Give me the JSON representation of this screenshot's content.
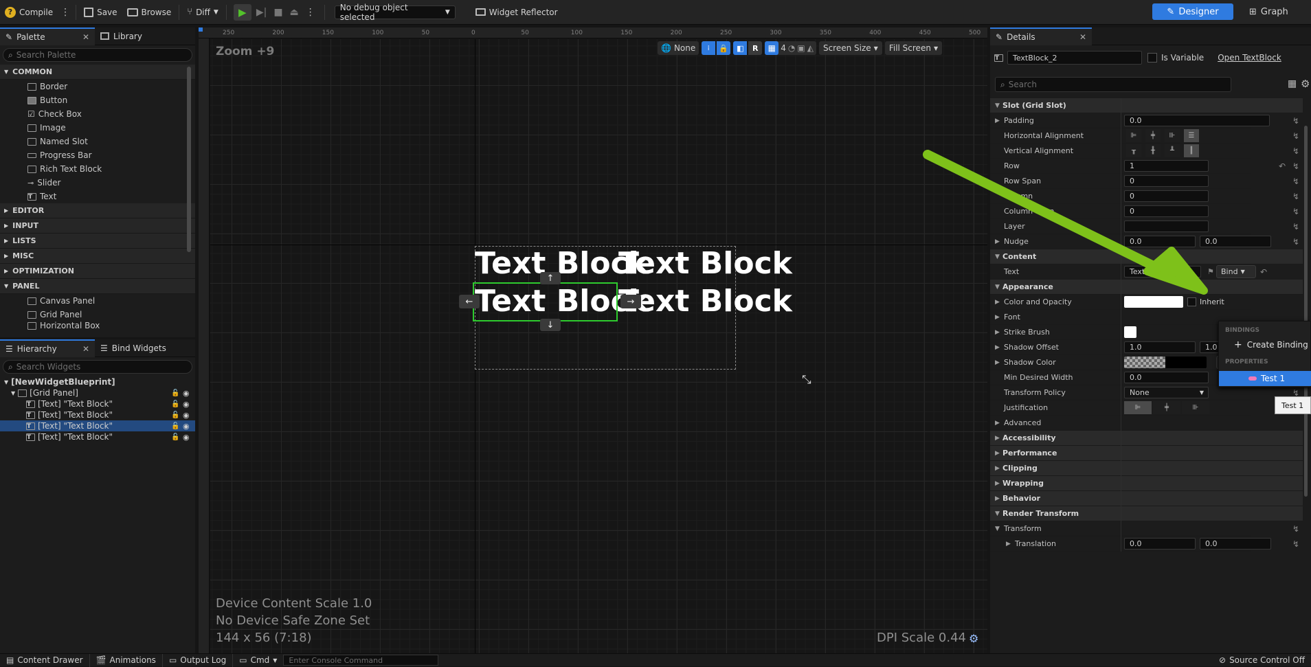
{
  "toolbar": {
    "compile": "Compile",
    "save": "Save",
    "browse": "Browse",
    "diff": "Diff",
    "debug_select": "No debug object selected",
    "widget_reflector": "Widget Reflector",
    "designer": "Designer",
    "graph": "Graph"
  },
  "palette": {
    "tab": "Palette",
    "library_tab": "Library",
    "search_placeholder": "Search Palette",
    "common": "COMMON",
    "items": [
      "Border",
      "Button",
      "Check Box",
      "Image",
      "Named Slot",
      "Progress Bar",
      "Rich Text Block",
      "Slider",
      "Text"
    ],
    "categories": [
      "EDITOR",
      "INPUT",
      "LISTS",
      "MISC",
      "OPTIMIZATION",
      "PANEL"
    ],
    "panel_items": [
      "Canvas Panel",
      "Grid Panel",
      "Horizontal Box"
    ]
  },
  "hierarchy": {
    "tab": "Hierarchy",
    "bind_tab": "Bind Widgets",
    "search_placeholder": "Search Widgets",
    "root": "[NewWidgetBlueprint]",
    "grid": "[Grid Panel]",
    "rows": [
      "[Text] \"Text Block\"",
      "[Text] \"Text Block\"",
      "[Text] \"Text Block\"",
      "[Text] \"Text Block\""
    ]
  },
  "canvas": {
    "zoom": "Zoom +9",
    "none_label": "None",
    "r_label": "R",
    "grid_value": "4",
    "screen_size": "Screen Size",
    "fill_screen": "Fill Screen",
    "text_block": "Text Block",
    "device_scale": "Device Content Scale 1.0",
    "safe_zone": "No Device Safe Zone Set",
    "size": "144 x 56 (7:18)",
    "dpi": "DPI Scale 0.44",
    "ruler_top": [
      "250",
      "200",
      "150",
      "100",
      "50",
      "0",
      "50",
      "100",
      "150",
      "200",
      "250",
      "300",
      "350",
      "400",
      "450",
      "500"
    ]
  },
  "details": {
    "tab": "Details",
    "widget_name": "TextBlock_2",
    "is_variable": "Is Variable",
    "open_link": "Open TextBlock",
    "search_placeholder": "Search",
    "slot_section": "Slot (Grid Slot)",
    "padding": "Padding",
    "padding_value": "0.0",
    "h_align": "Horizontal Alignment",
    "v_align": "Vertical Alignment",
    "row": "Row",
    "row_value": "1",
    "row_span": "Row Span",
    "row_span_value": "0",
    "column": "Column",
    "column_value": "0",
    "column_span": "Column Span",
    "column_span_value": "0",
    "layer": "Layer",
    "nudge": "Nudge",
    "nudge_x": "0.0",
    "nudge_y": "0.0",
    "content_section": "Content",
    "text": "Text",
    "text_value": "Text Block",
    "bind": "Bind",
    "appearance_section": "Appearance",
    "color_opacity": "Color and Opacity",
    "inherit": "Inherit",
    "font": "Font",
    "strike_brush": "Strike Brush",
    "shadow_offset": "Shadow Offset",
    "shadow_x": "1.0",
    "shadow_y": "1.0",
    "shadow_color": "Shadow Color",
    "min_width": "Min Desired Width",
    "min_width_value": "0.0",
    "transform_policy": "Transform Policy",
    "transform_policy_value": "None",
    "justification": "Justification",
    "advanced": "Advanced",
    "accessibility": "Accessibility",
    "performance": "Performance",
    "clipping": "Clipping",
    "wrapping": "Wrapping",
    "behavior": "Behavior",
    "render_transform": "Render Transform",
    "transform": "Transform",
    "translation": "Translation",
    "translation_x": "0.0",
    "translation_y": "0.0"
  },
  "binding_popup": {
    "bindings_header": "BINDINGS",
    "create_binding": "Create Binding",
    "properties_header": "PROPERTIES",
    "property_item": "Test 1",
    "tooltip": "Test 1"
  },
  "bottombar": {
    "content_drawer": "Content Drawer",
    "animations": "Animations",
    "output_log": "Output Log",
    "cmd": "Cmd",
    "console_placeholder": "Enter Console Command",
    "source_control": "Source Control Off"
  },
  "colors": {
    "accent_blue": "#2f7be0",
    "selection_green": "#2ecc2e",
    "arrow_green": "#7ec11a"
  }
}
